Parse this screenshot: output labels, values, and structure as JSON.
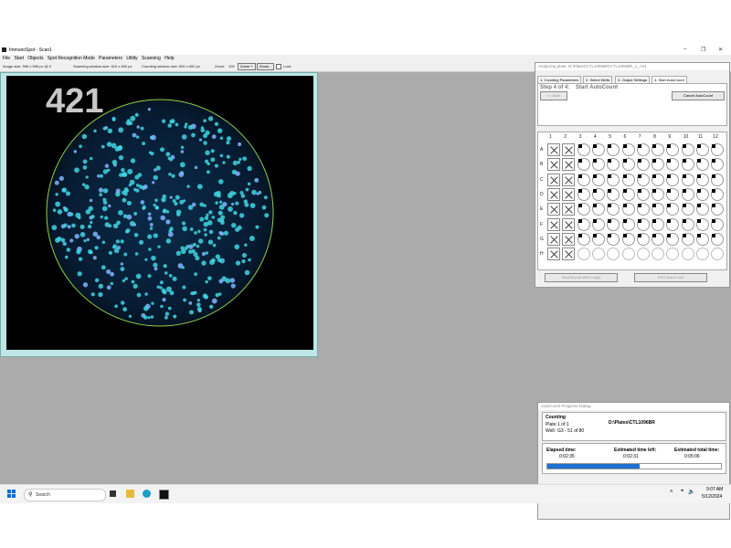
{
  "window": {
    "title": "ImmunoSpot - Scan1"
  },
  "menu": [
    "File",
    "Start",
    "Objects",
    "Spot Recognition Mode",
    "Parameters",
    "Utility",
    "Scanning",
    "Help"
  ],
  "infobar": {
    "image_size": "Image size: 596 x 596 px @ 0",
    "scanning_window": "Scanning window size: 610 x 600 px",
    "counting_window": "Counting window size: 600 x 600 px",
    "zoom_label": "Zoom:",
    "zoom_value": "100",
    "zoom_in": "Zoom +",
    "zoom_out": "Zoom -",
    "lock": "Lock"
  },
  "image": {
    "count": "421"
  },
  "plate": {
    "header": "Analyzing plate:  D:\\Plates\\CTL1096BR\\CTL1096BR_1_A01",
    "tabs": [
      "1. Counting Parameters",
      "2. Select Wells",
      "3. Output Settings",
      "4. Start AutoCount"
    ],
    "active_tab": 3,
    "step_label": "Step 4 of 4:",
    "step_title": "Start AutoCount",
    "back_button": "<< Back",
    "cancel_button": "Cancel AutoCount",
    "columns": [
      "1",
      "2",
      "3",
      "4",
      "5",
      "6",
      "7",
      "8",
      "9",
      "10",
      "11",
      "12"
    ],
    "rows": [
      "A",
      "B",
      "C",
      "D",
      "E",
      "F",
      "G",
      "H"
    ],
    "excluded_columns": [
      1,
      2
    ],
    "done_through_row": "G",
    "done_through_col": 3,
    "save_button": "Save/Export Well Image",
    "exit_button": "EXIT AutoCount"
  },
  "progress": {
    "header": "AutoCount Progress Dialog",
    "status": "Counting",
    "plate_label": "Plate:",
    "plate_value": "1 of 1",
    "well_label": "Well:",
    "well_value": "G3  -  51 of 80",
    "path": "D:\\Plates\\CTL1096BR",
    "elapsed_label": "Elapsed time:",
    "elapsed_value": "0:02:35",
    "left_label": "Estimated time left:",
    "left_value": "0:02:31",
    "total_label": "Estimated total time:",
    "total_value": "0:05:06",
    "progress_fraction": 0.53
  },
  "taskbar": {
    "search": "Search",
    "time": "9:07 AM",
    "date": "5/12/2024"
  },
  "colors": {
    "desktop": "#ababab",
    "accent": "#1f6fd0",
    "spot": "#3fd6e0",
    "plate_rim": "#9be04a"
  }
}
